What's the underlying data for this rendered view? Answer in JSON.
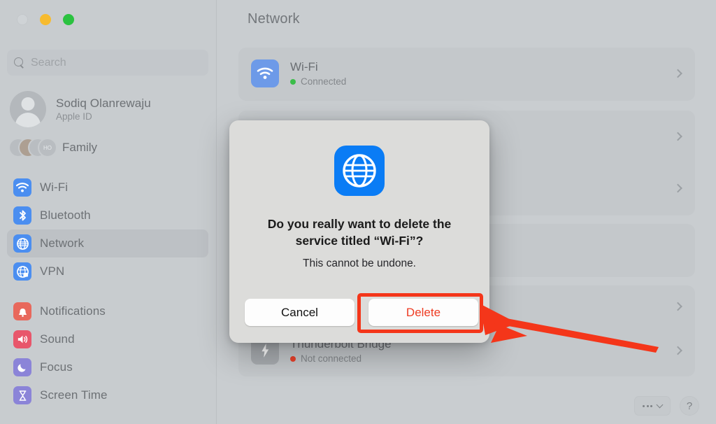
{
  "window": {
    "traffic_lights": [
      "close",
      "minimize",
      "maximize"
    ]
  },
  "sidebar": {
    "search": {
      "placeholder": "Search",
      "value": "",
      "icon": "search-icon"
    },
    "account": {
      "name": "Sodiq Olanrewaju",
      "subtitle": "Apple ID",
      "icon": "avatar-icon"
    },
    "family": {
      "label": "Family",
      "avatar_initials": [
        "",
        "",
        "",
        "HO"
      ]
    },
    "groups": [
      {
        "name": "connectivity",
        "items": [
          {
            "label": "Wi-Fi",
            "icon": "wifi-icon",
            "color": "#4b8ef0",
            "selected": false
          },
          {
            "label": "Bluetooth",
            "icon": "bluetooth-icon",
            "color": "#4b8ef0",
            "selected": false
          },
          {
            "label": "Network",
            "icon": "globe-icon",
            "color": "#4b8ef0",
            "selected": true
          },
          {
            "label": "VPN",
            "icon": "vpn-globe-icon",
            "color": "#4b8ef0",
            "selected": false
          }
        ]
      },
      {
        "name": "system",
        "items": [
          {
            "label": "Notifications",
            "icon": "bell-icon",
            "color": "#e8685c",
            "selected": false
          },
          {
            "label": "Sound",
            "icon": "speaker-icon",
            "color": "#e8566b",
            "selected": false
          },
          {
            "label": "Focus",
            "icon": "moon-icon",
            "color": "#8b84d8",
            "selected": false
          },
          {
            "label": "Screen Time",
            "icon": "hourglass-icon",
            "color": "#8b84d8",
            "selected": false
          }
        ]
      }
    ]
  },
  "main": {
    "title": "Network",
    "services": [
      {
        "name": "Wi-Fi",
        "status": "Connected",
        "status_color": "#3bbd4a",
        "icon": "wifi-icon",
        "icon_color": "#6d9ae8"
      },
      {
        "name": "Thunderbolt Bridge",
        "status": "Not connected",
        "status_color": "#e8412b",
        "icon": "thunderbolt-icon",
        "icon_color": "#a8acb0"
      }
    ],
    "bottom_controls": {
      "more_label": "•••",
      "help_label": "?"
    }
  },
  "dialog": {
    "icon": "globe-icon",
    "icon_color": "#0a7cf5",
    "title": "Do you really want to delete the service titled “Wi-Fi”?",
    "message": "This cannot be undone.",
    "cancel_label": "Cancel",
    "delete_label": "Delete",
    "delete_color": "#ee3b22"
  },
  "annotation": {
    "highlight_color": "#f4361a",
    "target": "delete-button"
  }
}
